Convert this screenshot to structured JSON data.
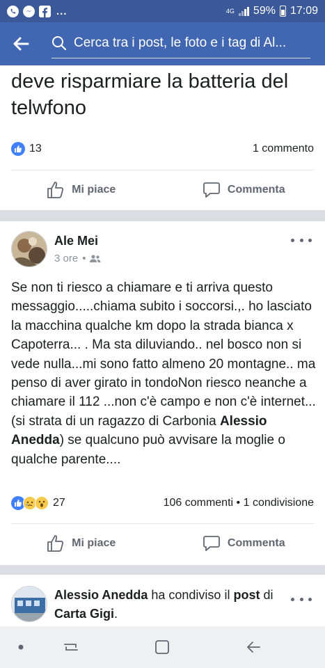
{
  "status_bar": {
    "left_icons": [
      "whatsapp-icon",
      "messenger-icon",
      "facebook-icon"
    ],
    "dots": "...",
    "network": "4G",
    "battery": "59%",
    "time": "17:09"
  },
  "search": {
    "placeholder": "Cerca tra i post, le foto e i tag di Al..."
  },
  "previous_post": {
    "text": "deve risparmiare la batteria del telwfono",
    "reaction_count": "13",
    "comments": "1 commento",
    "like_label": "Mi piace",
    "comment_label": "Commenta"
  },
  "post": {
    "author": "Ale Mei",
    "time": "3 ore",
    "separator": "•",
    "audience_icon": "friends-icon",
    "body_part1": "Se non ti riesco a chiamare e ti arriva questo messaggio.....chiama subito i soccorsi.,. ho lasciato la macchina qualche km dopo la strada bianca x Capoterra... . Ma sta diluviando.. nel bosco non si vede nulla...mi sono fatto almeno 20 montagne.. ma penso di aver girato in tondoNon riesco neanche a chiamare il 112 ...non c'è campo e non c'è internet... (si strata di un ragazzo di Carbonia ",
    "body_bold": "Alessio Anedda",
    "body_part2": ") se qualcuno può avvisare la moglie o qualche parente....",
    "reaction_count": "27",
    "comments": "106 commenti",
    "dot": "•",
    "shares": "1 condivisione",
    "like_label": "Mi piace",
    "comment_label": "Commenta"
  },
  "shared_post": {
    "author": "Alessio Anedda",
    "action": " ha condiviso il ",
    "post_word": "post",
    "of_word": " di ",
    "source": "Carta Gigi",
    "end": "."
  },
  "colors": {
    "header": "#4267b2",
    "status": "#3b5998",
    "like_blue": "#4080ff"
  }
}
